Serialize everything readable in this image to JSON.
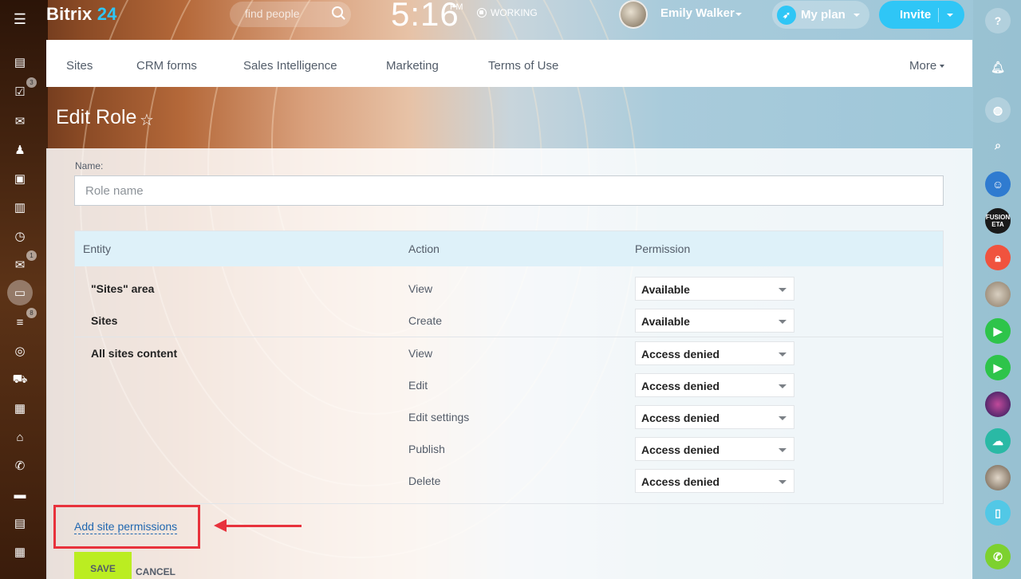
{
  "app": {
    "logo_text": "Bitrix",
    "logo_number": "24"
  },
  "header": {
    "search_placeholder": "find people",
    "clock_time": "5:16",
    "clock_ampm": "PM",
    "work_status": "WORKING",
    "user_name": "Emily Walker",
    "my_plan_label": "My plan",
    "invite_label": "Invite"
  },
  "left_rail": {
    "badges": {
      "tasks": "3",
      "mail": "1",
      "filters": "8"
    }
  },
  "right_rail": {
    "fusion_avatar_text": "FUSION ETA"
  },
  "nav": {
    "items": [
      "Sites",
      "CRM forms",
      "Sales Intelligence",
      "Marketing",
      "Terms of Use"
    ],
    "more_label": "More"
  },
  "page": {
    "title": "Edit Role"
  },
  "form": {
    "name_label": "Name:",
    "name_placeholder": "Role name",
    "table": {
      "headers": {
        "entity": "Entity",
        "action": "Action",
        "permission": "Permission"
      },
      "rows": [
        {
          "entity": "\"Sites\" area",
          "action": "View",
          "permission": "Available"
        },
        {
          "entity": "Sites",
          "action": "Create",
          "permission": "Available"
        },
        {
          "entity": "All sites content",
          "action": "View",
          "permission": "Access denied"
        },
        {
          "entity": "",
          "action": "Edit",
          "permission": "Access denied"
        },
        {
          "entity": "",
          "action": "Edit settings",
          "permission": "Access denied"
        },
        {
          "entity": "",
          "action": "Publish",
          "permission": "Access denied"
        },
        {
          "entity": "",
          "action": "Delete",
          "permission": "Access denied"
        }
      ]
    },
    "add_permissions_link": "Add site permissions",
    "save_label": "SAVE",
    "cancel_label": "CANCEL"
  },
  "colors": {
    "accent_blue": "#2fc6f6",
    "save_green": "#bbed21",
    "highlight_red": "#e8323c",
    "table_header": "#def1f9"
  }
}
